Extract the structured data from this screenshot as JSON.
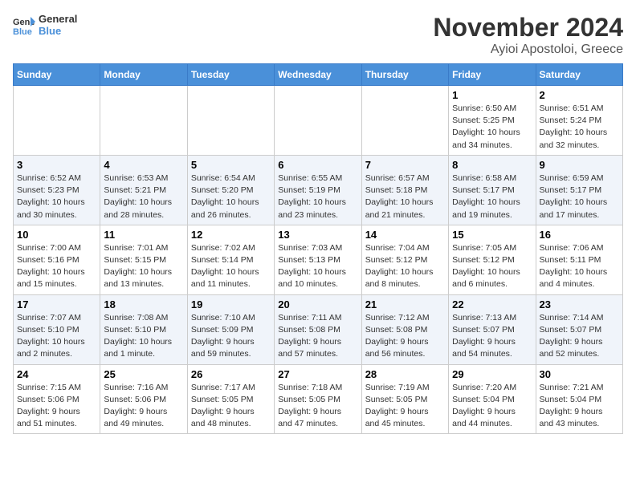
{
  "logo": {
    "line1": "General",
    "line2": "Blue"
  },
  "title": "November 2024",
  "subtitle": "Ayioi Apostoloi, Greece",
  "weekdays": [
    "Sunday",
    "Monday",
    "Tuesday",
    "Wednesday",
    "Thursday",
    "Friday",
    "Saturday"
  ],
  "weeks": [
    [
      {
        "day": "",
        "info": ""
      },
      {
        "day": "",
        "info": ""
      },
      {
        "day": "",
        "info": ""
      },
      {
        "day": "",
        "info": ""
      },
      {
        "day": "",
        "info": ""
      },
      {
        "day": "1",
        "info": "Sunrise: 6:50 AM\nSunset: 5:25 PM\nDaylight: 10 hours\nand 34 minutes."
      },
      {
        "day": "2",
        "info": "Sunrise: 6:51 AM\nSunset: 5:24 PM\nDaylight: 10 hours\nand 32 minutes."
      }
    ],
    [
      {
        "day": "3",
        "info": "Sunrise: 6:52 AM\nSunset: 5:23 PM\nDaylight: 10 hours\nand 30 minutes."
      },
      {
        "day": "4",
        "info": "Sunrise: 6:53 AM\nSunset: 5:21 PM\nDaylight: 10 hours\nand 28 minutes."
      },
      {
        "day": "5",
        "info": "Sunrise: 6:54 AM\nSunset: 5:20 PM\nDaylight: 10 hours\nand 26 minutes."
      },
      {
        "day": "6",
        "info": "Sunrise: 6:55 AM\nSunset: 5:19 PM\nDaylight: 10 hours\nand 23 minutes."
      },
      {
        "day": "7",
        "info": "Sunrise: 6:57 AM\nSunset: 5:18 PM\nDaylight: 10 hours\nand 21 minutes."
      },
      {
        "day": "8",
        "info": "Sunrise: 6:58 AM\nSunset: 5:17 PM\nDaylight: 10 hours\nand 19 minutes."
      },
      {
        "day": "9",
        "info": "Sunrise: 6:59 AM\nSunset: 5:17 PM\nDaylight: 10 hours\nand 17 minutes."
      }
    ],
    [
      {
        "day": "10",
        "info": "Sunrise: 7:00 AM\nSunset: 5:16 PM\nDaylight: 10 hours\nand 15 minutes."
      },
      {
        "day": "11",
        "info": "Sunrise: 7:01 AM\nSunset: 5:15 PM\nDaylight: 10 hours\nand 13 minutes."
      },
      {
        "day": "12",
        "info": "Sunrise: 7:02 AM\nSunset: 5:14 PM\nDaylight: 10 hours\nand 11 minutes."
      },
      {
        "day": "13",
        "info": "Sunrise: 7:03 AM\nSunset: 5:13 PM\nDaylight: 10 hours\nand 10 minutes."
      },
      {
        "day": "14",
        "info": "Sunrise: 7:04 AM\nSunset: 5:12 PM\nDaylight: 10 hours\nand 8 minutes."
      },
      {
        "day": "15",
        "info": "Sunrise: 7:05 AM\nSunset: 5:12 PM\nDaylight: 10 hours\nand 6 minutes."
      },
      {
        "day": "16",
        "info": "Sunrise: 7:06 AM\nSunset: 5:11 PM\nDaylight: 10 hours\nand 4 minutes."
      }
    ],
    [
      {
        "day": "17",
        "info": "Sunrise: 7:07 AM\nSunset: 5:10 PM\nDaylight: 10 hours\nand 2 minutes."
      },
      {
        "day": "18",
        "info": "Sunrise: 7:08 AM\nSunset: 5:10 PM\nDaylight: 10 hours\nand 1 minute."
      },
      {
        "day": "19",
        "info": "Sunrise: 7:10 AM\nSunset: 5:09 PM\nDaylight: 9 hours\nand 59 minutes."
      },
      {
        "day": "20",
        "info": "Sunrise: 7:11 AM\nSunset: 5:08 PM\nDaylight: 9 hours\nand 57 minutes."
      },
      {
        "day": "21",
        "info": "Sunrise: 7:12 AM\nSunset: 5:08 PM\nDaylight: 9 hours\nand 56 minutes."
      },
      {
        "day": "22",
        "info": "Sunrise: 7:13 AM\nSunset: 5:07 PM\nDaylight: 9 hours\nand 54 minutes."
      },
      {
        "day": "23",
        "info": "Sunrise: 7:14 AM\nSunset: 5:07 PM\nDaylight: 9 hours\nand 52 minutes."
      }
    ],
    [
      {
        "day": "24",
        "info": "Sunrise: 7:15 AM\nSunset: 5:06 PM\nDaylight: 9 hours\nand 51 minutes."
      },
      {
        "day": "25",
        "info": "Sunrise: 7:16 AM\nSunset: 5:06 PM\nDaylight: 9 hours\nand 49 minutes."
      },
      {
        "day": "26",
        "info": "Sunrise: 7:17 AM\nSunset: 5:05 PM\nDaylight: 9 hours\nand 48 minutes."
      },
      {
        "day": "27",
        "info": "Sunrise: 7:18 AM\nSunset: 5:05 PM\nDaylight: 9 hours\nand 47 minutes."
      },
      {
        "day": "28",
        "info": "Sunrise: 7:19 AM\nSunset: 5:05 PM\nDaylight: 9 hours\nand 45 minutes."
      },
      {
        "day": "29",
        "info": "Sunrise: 7:20 AM\nSunset: 5:04 PM\nDaylight: 9 hours\nand 44 minutes."
      },
      {
        "day": "30",
        "info": "Sunrise: 7:21 AM\nSunset: 5:04 PM\nDaylight: 9 hours\nand 43 minutes."
      }
    ]
  ]
}
